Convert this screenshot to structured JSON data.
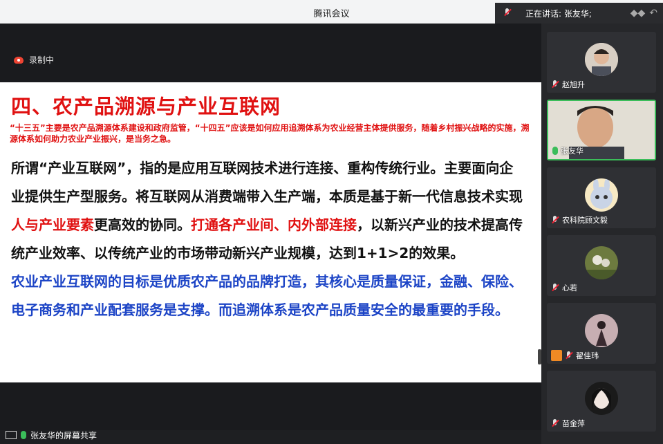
{
  "app": {
    "title": "腾讯会议"
  },
  "speaking": {
    "label": "正在讲话: 张友华;"
  },
  "recording": {
    "label": "录制中"
  },
  "slide": {
    "heading": "四、农产品溯源与产业互联网",
    "note": "“十三五”主要是农产品溯源体系建设和政府监管，“十四五”应该是如何应用追溯体系为农业经营主体提供服务，随着乡村振兴战略的实施，溯源体系如何助力农业产业振兴，是当务之急。",
    "p1a": "所谓“产业互联网”，指的是应用互联网技术进行连接、重构传统行业。主要面向企业提供生产型服务。将互联网从消费端带入生产端，本质是基于新一代信息技术实现",
    "p1b": "人与产业要素",
    "p1c": "更高效的协同。",
    "p1d": "打通各产业间、内外部连接",
    "p1e": "，以新兴产业的技术提高传统产业效率、以传统产业的市场带动新兴产业规模，达到1+1>2的效果。",
    "p2": "农业产业互联网的目标是优质农产品的品牌打造，其核心是质量保证，金融、保险、电子商务和产业配套服务是支撑。而追溯体系是农产品质量安全的最重要的手段。"
  },
  "share": {
    "label": "张友华的屏幕共享"
  },
  "participants": [
    {
      "name": "赵旭升",
      "mic": "muted"
    },
    {
      "name": "张友华",
      "mic": "live"
    },
    {
      "name": "农科院顾文毅",
      "mic": "muted"
    },
    {
      "name": "心若",
      "mic": "muted"
    },
    {
      "name": "翟佳玮",
      "mic": "muted"
    },
    {
      "name": "苗金萍",
      "mic": "muted"
    }
  ]
}
